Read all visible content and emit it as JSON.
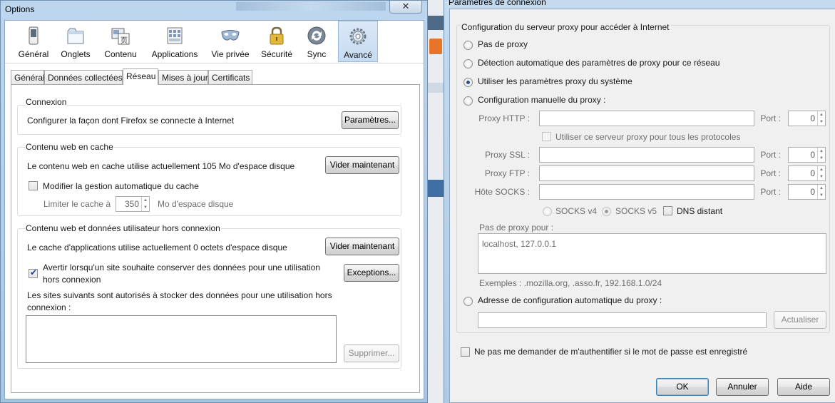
{
  "options": {
    "window_title": "Options",
    "close_glyph": "✕",
    "toolbar": [
      {
        "label": "Général",
        "icon": "switch-icon"
      },
      {
        "label": "Onglets",
        "icon": "tabs-icon"
      },
      {
        "label": "Contenu",
        "icon": "content-icon"
      },
      {
        "label": "Applications",
        "icon": "applications-icon"
      },
      {
        "label": "Vie privée",
        "icon": "mask-icon"
      },
      {
        "label": "Sécurité",
        "icon": "lock-icon"
      },
      {
        "label": "Sync",
        "icon": "sync-icon"
      },
      {
        "label": "Avancé",
        "icon": "gear-icon"
      }
    ],
    "tabs": [
      "Général",
      "Données collectées",
      "Réseau",
      "Mises à jour",
      "Certificats"
    ],
    "active_tab": "Réseau",
    "connexion": {
      "title": "Connexion",
      "text": "Configurer la façon dont Firefox se connecte à Internet",
      "button": "Paramètres..."
    },
    "cache": {
      "title": "Contenu web en cache",
      "text": "Le contenu web en cache utilise actuellement 105 Mo d'espace disque",
      "button": "Vider maintenant",
      "override_label": "Modifier la gestion automatique du cache",
      "override_checked": false,
      "limit_label": "Limiter le cache à",
      "limit_value": "350",
      "limit_unit": "Mo d'espace disque"
    },
    "offline": {
      "title": "Contenu web et données utilisateur hors connexion",
      "text": "Le cache d'applications utilise actuellement 0 octets d'espace disque",
      "button": "Vider maintenant",
      "warn_label_1": "Avertir lorsqu'un site souhaite conserver des données pour une utilisation",
      "warn_label_2": "hors connexion",
      "warn_checked": true,
      "exceptions_button": "Exceptions...",
      "allowed_text_1": "Les sites suivants sont autorisés à stocker des données pour une utilisation hors",
      "allowed_text_2": "connexion :",
      "remove_button": "Supprimer..."
    }
  },
  "connection": {
    "window_title": "Paramètres de connexion",
    "group_title": "Configuration du serveur proxy pour accéder à Internet",
    "options": [
      {
        "label": "Pas de proxy",
        "selected": false
      },
      {
        "label": "Détection automatique des paramètres de proxy pour ce réseau",
        "selected": false
      },
      {
        "label": "Utiliser les paramètres proxy du système",
        "selected": true
      },
      {
        "label": "Configuration manuelle du proxy :",
        "selected": false
      }
    ],
    "http_label": "Proxy HTTP :",
    "ssl_label": "Proxy SSL :",
    "ftp_label": "Proxy FTP :",
    "socks_label": "Hôte SOCKS :",
    "port_label": "Port :",
    "port_value": "0",
    "share_label": "Utiliser ce serveur proxy pour tous les protocoles",
    "socks_v4": "SOCKS v4",
    "socks_v5": "SOCKS v5",
    "dns_label": "DNS distant",
    "no_proxy_label": "Pas de proxy pour :",
    "no_proxy_value": "localhost, 127.0.0.1",
    "example": "Exemples : .mozilla.org, .asso.fr, 192.168.1.0/24",
    "auto_config_label": "Adresse de configuration automatique du proxy :",
    "reload_button": "Actualiser",
    "no_auth_label": "Ne pas me demander de m'authentifier si le mot de passe est enregistré",
    "ok_button": "OK",
    "cancel_button": "Annuler",
    "help_button": "Aide"
  }
}
